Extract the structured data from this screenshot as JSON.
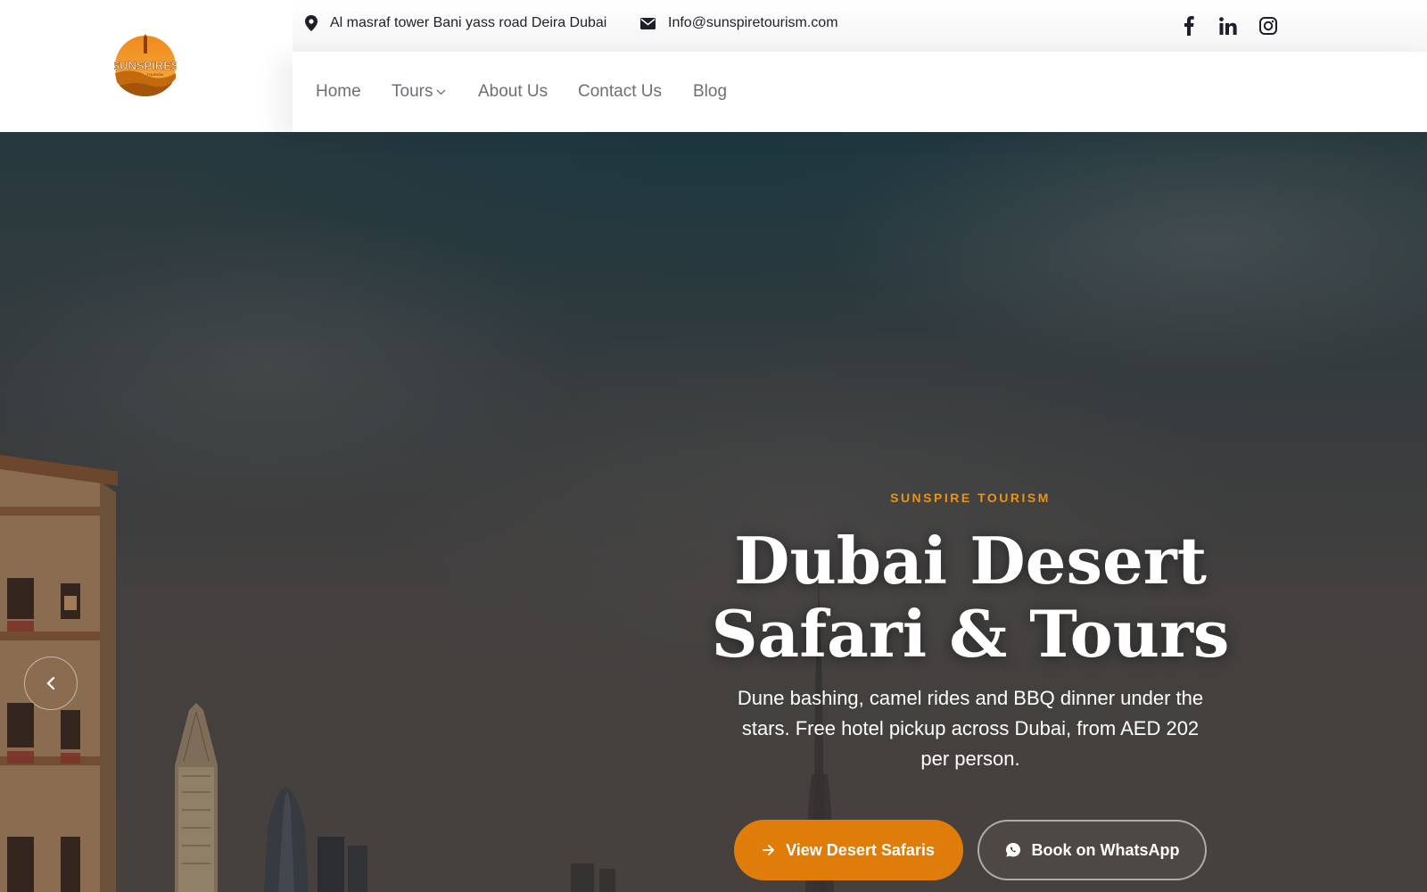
{
  "brand": {
    "logo_text": "SUNSPIRES",
    "logo_subtext": "TOURISM",
    "accent_color": "#e07d0a"
  },
  "topbar": {
    "address": "Al masraf tower Bani yass road Deira Dubai",
    "email": "Info@sunspiretourism.com",
    "social": [
      {
        "name": "facebook-icon"
      },
      {
        "name": "linkedin-icon"
      },
      {
        "name": "instagram-icon"
      }
    ]
  },
  "nav": {
    "items": [
      {
        "label": "Home"
      },
      {
        "label": "Tours",
        "has_dropdown": true
      },
      {
        "label": "About Us"
      },
      {
        "label": "Contact Us"
      },
      {
        "label": "Blog"
      }
    ]
  },
  "hero": {
    "eyebrow": "SUNSPIRE TOURISM",
    "title_line1": "Dubai Desert",
    "title_line2": "Safari & Tours",
    "subtitle": "Dune bashing, camel rides and BBQ dinner under the stars. Free hotel pickup across Dubai, from AED 202 per person.",
    "primary_button": "View Desert Safaris",
    "secondary_button": "Book on WhatsApp",
    "prev_icon": "chevron-left-icon"
  }
}
